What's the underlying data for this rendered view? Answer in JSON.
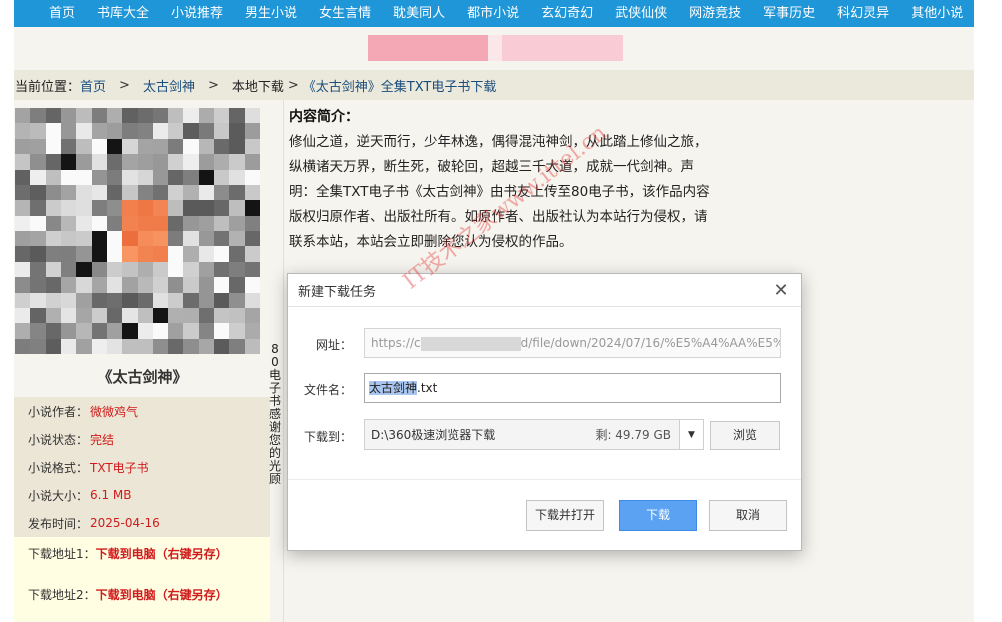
{
  "nav": [
    "首页",
    "书库大全",
    "小说推荐",
    "男生小说",
    "女生言情",
    "耽美同人",
    "都市小说",
    "玄幻奇幻",
    "武侠仙侠",
    "网游竞技",
    "军事历史",
    "科幻灵异",
    "其他小说"
  ],
  "breadcrumb": {
    "prefix": "当前位置：",
    "home": "首页",
    "category": "太古剑神",
    "section": "本地下载",
    "current": "《太古剑神》全集TXT电子书下载",
    "separator": ">"
  },
  "book": {
    "title": "《太古剑神》",
    "author_label": "小说作者：",
    "author": "微微鸡气",
    "status_label": "小说状态：",
    "status": "完结",
    "format_label": "小说格式：",
    "format": "TXT电子书",
    "size_label": "小说大小：",
    "size": "6.1 MB",
    "date_label": "发布时间：",
    "date": "2025-04-16",
    "dl1_label": "下载地址1：",
    "dl1": "下载到电脑（右键另存）",
    "dl2_label": "下载地址2：",
    "dl2": "下载到电脑（右键另存）"
  },
  "side_thanks": "80电子书感谢您的光顾",
  "intro": {
    "title": "内容简介：",
    "text": "修仙之道，逆天而行，少年林逸，偶得混沌神剑，从此踏上修仙之旅，纵横诸天万界，断生死，破轮回，超越三千大道，成就一代剑神。声明：全集TXT电子书《太古剑神》由书友上传至80电子书，该作品内容版权归原作者、出版社所有。如原作者、出版社认为本站行为侵权，请联系本站，本站会立即删除您认为侵权的作品。"
  },
  "watermark": "IT技术之家www.ittel.cn",
  "dialog": {
    "title": "新建下载任务",
    "url_label": "网址：",
    "url_prefix": "https://c",
    "url_suffix": "d/file/down/2024/07/16/%E5%A4%AA%E5%",
    "filename_label": "文件名：",
    "filename_selected": "太古剑神",
    "filename_ext": ".txt",
    "saveto_label": "下载到：",
    "path": "D:\\360极速浏览器下载",
    "free_space": "剩: 49.79 GB",
    "browse": "浏览",
    "download_open": "下载并打开",
    "download": "下载",
    "cancel": "取消"
  },
  "colors": {
    "nav": "#1f96d8",
    "primary_button": "#5ba2f2",
    "accent_red": "#d01b1b"
  }
}
